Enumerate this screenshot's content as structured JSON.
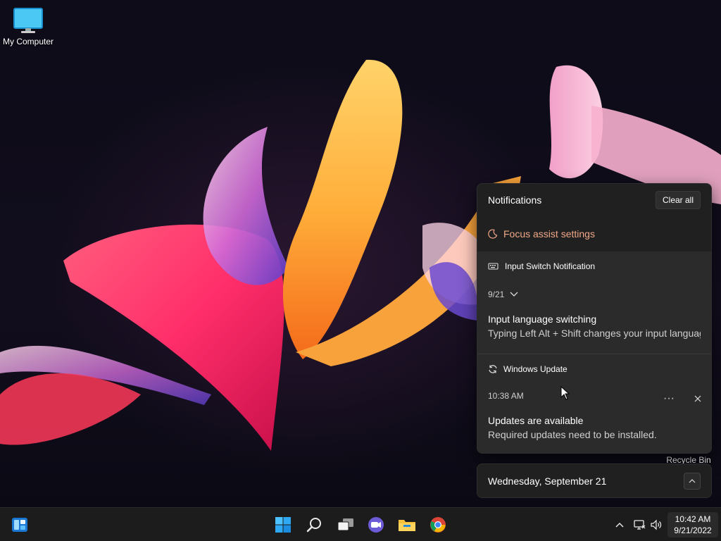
{
  "desktop": {
    "icons": [
      {
        "label": "My Computer",
        "icon": "computer-icon"
      },
      {
        "label": "Recycle Bin",
        "icon": "recycle-bin-icon"
      }
    ]
  },
  "notifications": {
    "title": "Notifications",
    "clear_all_label": "Clear all",
    "focus_assist_label": "Focus assist settings",
    "items": [
      {
        "app": "Input Switch Notification",
        "app_icon": "keyboard-icon",
        "time": "9/21",
        "title": "Input language switching",
        "body": "Typing Left Alt + Shift changes your input language"
      },
      {
        "app": "Windows Update",
        "app_icon": "refresh-icon",
        "time": "10:38 AM",
        "more_label": "···",
        "title": "Updates are available",
        "body": "Required updates need to be installed."
      }
    ]
  },
  "calendar": {
    "date_label": "Wednesday, September 21"
  },
  "taskbar": {
    "apps": [
      "widgets-icon",
      "windows-start-icon",
      "search-icon",
      "task-view-icon",
      "chat-icon",
      "file-explorer-icon",
      "chrome-icon"
    ],
    "tray_icons": [
      "chevron-up-icon",
      "network-icon",
      "volume-icon"
    ],
    "clock": {
      "time": "10:42 AM",
      "date": "9/21/2022"
    }
  },
  "colors": {
    "accent_focus": "#f0a888",
    "panel_bg": "#202020",
    "card_bg": "#2b2b2b",
    "taskbar_bg": "#1c1c1c"
  }
}
